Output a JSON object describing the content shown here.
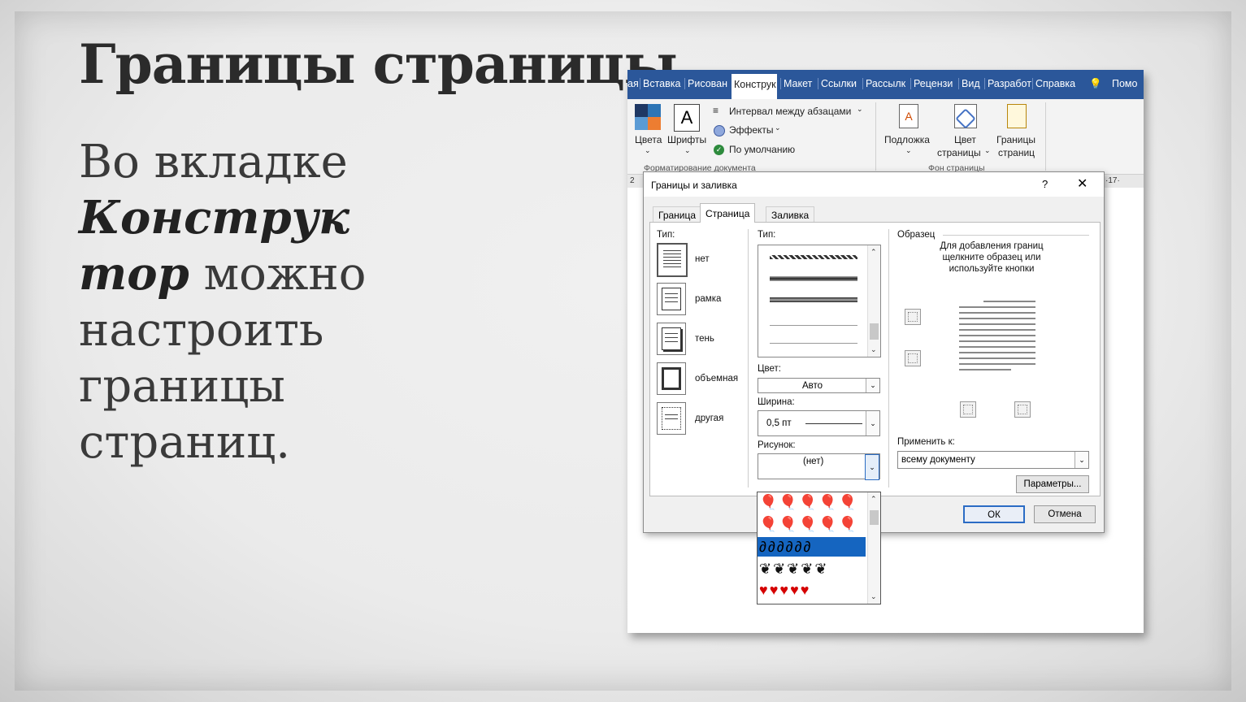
{
  "slide": {
    "title": "Границы страницы",
    "body_pre": "Во вкладке",
    "body_bold": "Конструктор",
    "body_bold_line1": "Конструк",
    "body_bold_line2": "тор",
    "body_post": "можно настроить границы страниц."
  },
  "ribbon": {
    "tabs": [
      "ая",
      "Вставка",
      "Рисован",
      "Конструк",
      "Макет",
      "Ссылки",
      "Рассылк",
      "Рецензи",
      "Вид",
      "Разработ",
      "Справка",
      "Помо"
    ],
    "active_tab": "Конструк",
    "colors_label": "Цвета",
    "fonts_label": "Шрифты",
    "paragraph_spacing": "Интервал между абзацами",
    "effects": "Эффекты",
    "default": "По умолчанию",
    "group_format": "Форматирование документа",
    "watermark": "Подложка",
    "page_color_1": "Цвет",
    "page_color_2": "страницы",
    "page_borders_1": "Границы",
    "page_borders_2": "страниц",
    "group_background": "Фон страницы",
    "ruler_left": "2",
    "ruler_right": "·17·"
  },
  "dialog": {
    "title": "Границы и заливка",
    "help": "?",
    "close": "✕",
    "tabs": [
      "Граница",
      "Страница",
      "Заливка"
    ],
    "active_tab": "Страница",
    "type_label": "Тип:",
    "settings": [
      "нет",
      "рамка",
      "тень",
      "объемная",
      "другая"
    ],
    "style_label": "Тип:",
    "color_label": "Цвет:",
    "color_value": "Авто",
    "width_label": "Ширина:",
    "width_value": "0,5 пт",
    "art_label": "Рисунок:",
    "art_value": "(нет)",
    "preview_label": "Образец",
    "preview_hint_1": "Для добавления границ",
    "preview_hint_2": "щелкните образец или",
    "preview_hint_3": "используйте кнопки",
    "apply_label": "Применить к:",
    "apply_value": "всему документу",
    "options_button": "Параметры...",
    "ok_button": "ОК",
    "cancel_button": "Отмена"
  },
  "colors": {
    "tabbar": "#2b579a",
    "ok_border": "#2b6cc4",
    "art_selected": "#1565c0",
    "hearts": "#d50000"
  }
}
